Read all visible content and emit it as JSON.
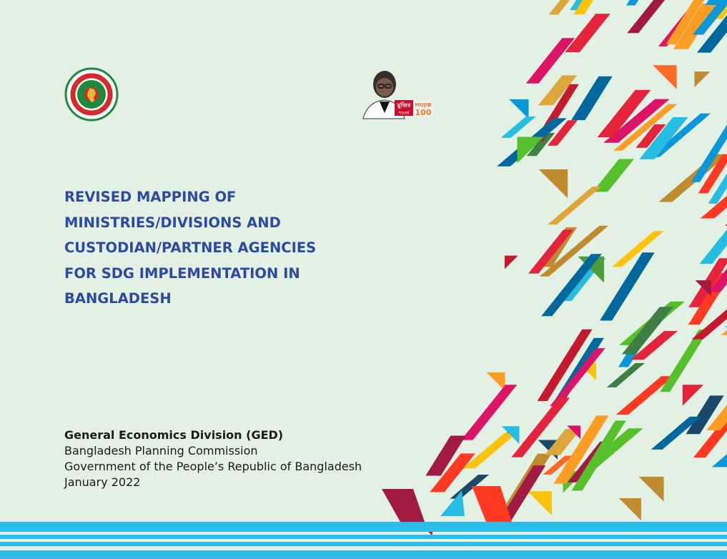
{
  "title_lines": [
    "REVISED MAPPING OF",
    "MINISTRIES/DIVISIONS AND",
    "CUSTODIAN/PARTNER AGENCIES",
    "FOR SDG IMPLEMENTATION IN",
    "BANGLADESH"
  ],
  "publisher": {
    "organization": "General Economics Division (GED)",
    "commission": "Bangladesh Planning Commission",
    "government": "Government of the People’s Republic of Bangladesh",
    "date": "January 2022"
  },
  "logos": {
    "government_seal_icon": "bangladesh-government-seal",
    "mujib_logo_icon": "mujib-100-logo",
    "mujib_text_bn": "মুজিব",
    "mujib_subtext_bn": "শতবর্ষ",
    "mujib_label": "MUJIB",
    "mujib_number": "100"
  },
  "colors": {
    "background": "#e2f1e4",
    "title": "#2b4aa3",
    "stripe": "#2bbde8",
    "sdg_palette": [
      "#e5243b",
      "#dda63a",
      "#4c9f38",
      "#c5192d",
      "#ff3a21",
      "#26bde2",
      "#fcc30b",
      "#a21942",
      "#fd6925",
      "#dd1367",
      "#fd9d24",
      "#bf8b2e",
      "#3f7e44",
      "#0a97d9",
      "#56c02b",
      "#00689d",
      "#19486a"
    ]
  }
}
